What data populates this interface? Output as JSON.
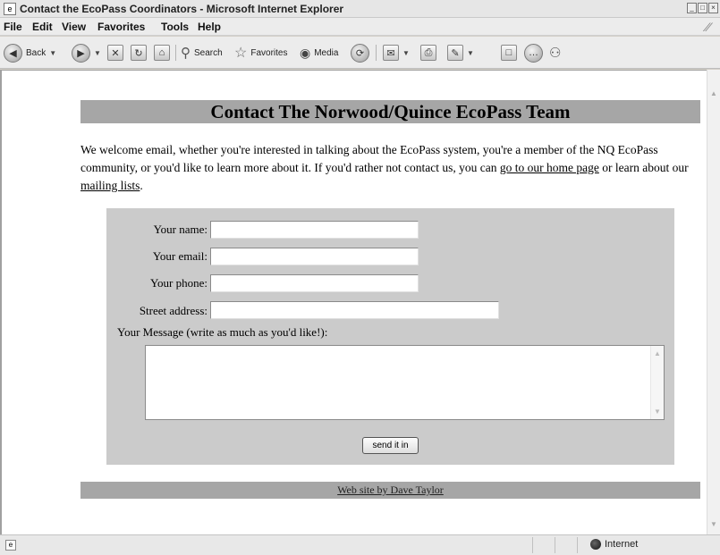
{
  "window": {
    "title": "Contact the EcoPass Coordinators - Microsoft Internet Explorer",
    "controls": [
      "_",
      "□",
      "×"
    ]
  },
  "menu": [
    "File",
    "Edit",
    "View",
    "Favorites",
    "Tools",
    "Help"
  ],
  "toolbar": {
    "back_label": "Back",
    "search_label": "Search",
    "favorites_label": "Favorites",
    "media_label": "Media"
  },
  "page": {
    "heading": "Contact The Norwood/Quince EcoPass Team",
    "intro_text": "We welcome email, whether you're interested in talking about the EcoPass system, you're a member of the NQ EcoPass community, or you'd like to learn more about it. If you'd rather not contact us, you can ",
    "home_link": "go to our home page",
    "intro_middle": " or learn about our ",
    "mailing_link": "mailing lists",
    "intro_end": "."
  },
  "form": {
    "name_label": "Your name:",
    "email_label": "Your email:",
    "phone_label": "Your phone:",
    "address_label": "Street address:",
    "message_label": "Your Message (write as much as you'd like!):",
    "name_value": "",
    "email_value": "",
    "phone_value": "",
    "address_value": "",
    "message_value": "",
    "submit_label": "send it in"
  },
  "footer": {
    "credit_link": "Web site by Dave Taylor"
  },
  "status": {
    "zone": "Internet"
  },
  "icons": {
    "back": "back-arrow-icon",
    "forward": "forward-arrow-icon",
    "stop": "stop-icon",
    "refresh": "refresh-icon",
    "home": "home-icon",
    "search": "search-icon",
    "favorites": "star-icon",
    "media": "media-icon",
    "history": "history-icon",
    "mail": "mail-icon",
    "print": "print-icon",
    "edit": "edit-icon",
    "discuss": "discuss-icon",
    "messenger": "messenger-icon"
  }
}
